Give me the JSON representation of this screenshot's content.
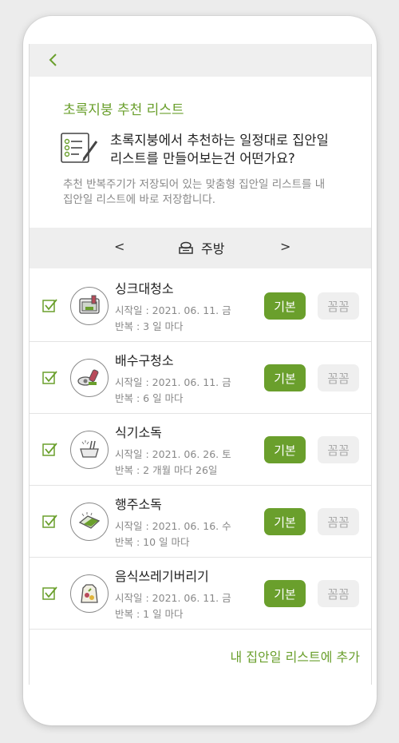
{
  "header": {
    "back_icon": "chevron-left-icon"
  },
  "intro": {
    "title": "초록지붕 추천 리스트",
    "headline_line1": "초록지붕에서 추천하는 일정대로 집안일",
    "headline_line2": "리스트를 만들어보는건 어떤가요?",
    "desc_line1": "추천 반복주기가 저장되어 있는 맞춤형 집안일 리스트를 내",
    "desc_line2": "집안일 리스트에 바로 저장합니다."
  },
  "category": {
    "prev": "<",
    "next": ">",
    "name": "주방",
    "icon": "stove-icon"
  },
  "items": [
    {
      "name": "싱크대청소",
      "start": "시작일 : 2021. 06. 11. 금",
      "repeat": "반복 : 3 일 마다",
      "basic": "기본",
      "thorough": "꼼꼼"
    },
    {
      "name": "배수구청소",
      "start": "시작일 : 2021. 06. 11. 금",
      "repeat": "반복 : 6 일 마다",
      "basic": "기본",
      "thorough": "꼼꼼"
    },
    {
      "name": "식기소독",
      "start": "시작일 : 2021. 06. 26. 토",
      "repeat": "반복 : 2 개월 마다 26일",
      "basic": "기본",
      "thorough": "꼼꼼"
    },
    {
      "name": "행주소독",
      "start": "시작일 : 2021. 06. 16. 수",
      "repeat": "반복 : 10 일 마다",
      "basic": "기본",
      "thorough": "꼼꼼"
    },
    {
      "name": "음식쓰레기버리기",
      "start": "시작일 : 2021. 06. 11. 금",
      "repeat": "반복 : 1 일 마다",
      "basic": "기본",
      "thorough": "꼼꼼"
    }
  ],
  "footer": {
    "add_label": "내 집안일 리스트에 추가"
  },
  "colors": {
    "accent": "#6a9f2c",
    "header_bg": "#efefef",
    "muted_text": "#888888"
  }
}
